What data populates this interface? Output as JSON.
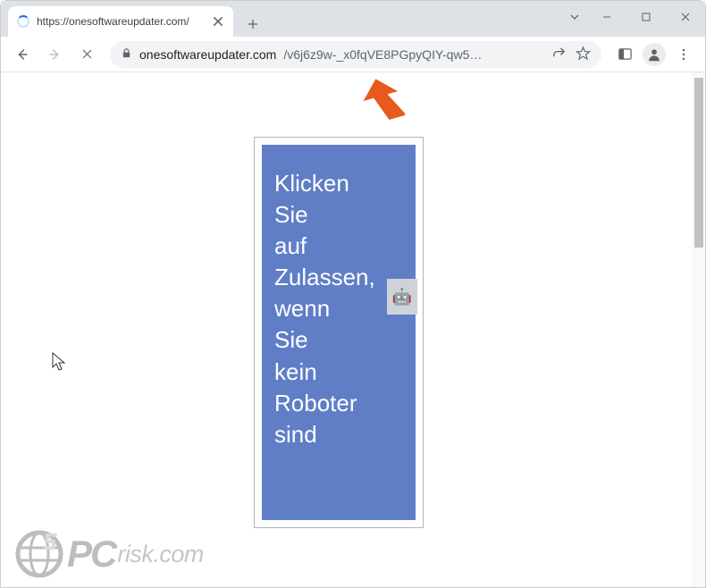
{
  "tab": {
    "title": "https://onesoftwareupdater.com/"
  },
  "address": {
    "domain": "onesoftwareupdater.com",
    "path": "/v6j6z9w-_x0fqVE8PGpyQIY-qw5…"
  },
  "page": {
    "words": [
      "Klicken",
      "Sie",
      "auf",
      "Zulassen,",
      "wenn",
      "Sie",
      "kein",
      "Roboter",
      "sind"
    ]
  },
  "watermark": {
    "prefix": "PC",
    "suffix": "risk.com"
  }
}
